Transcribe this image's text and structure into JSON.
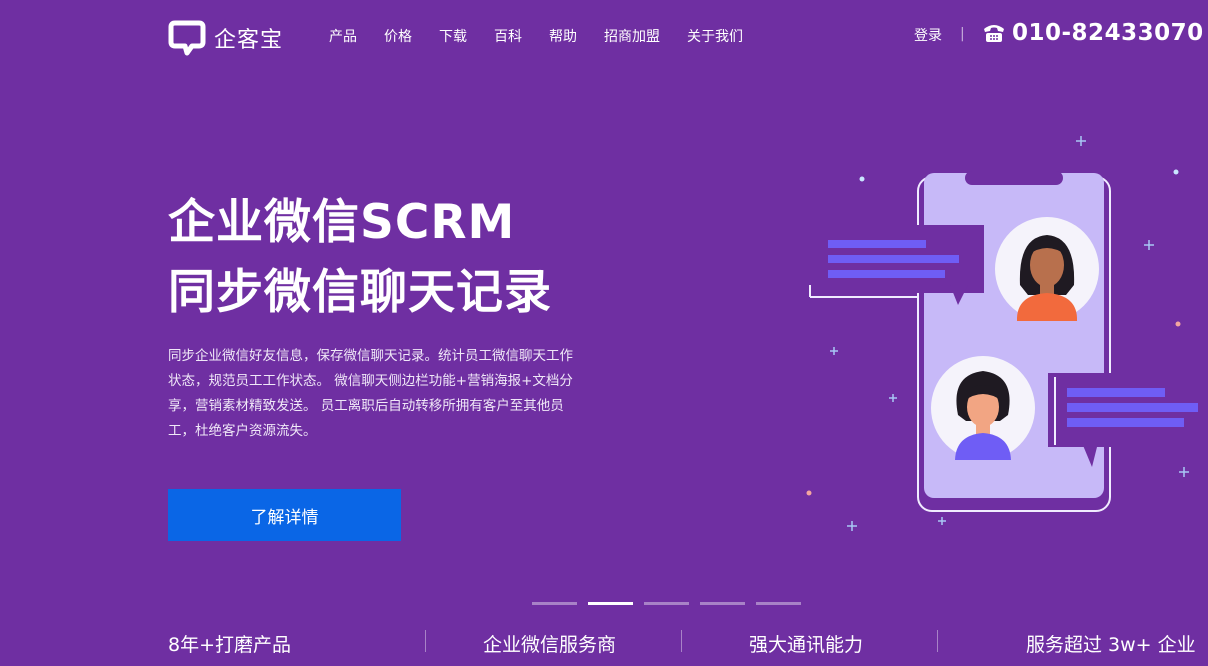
{
  "header": {
    "logo_text": "企客宝",
    "nav": [
      "产品",
      "价格",
      "下载",
      "百科",
      "帮助",
      "招商加盟",
      "关于我们"
    ],
    "login": "登录",
    "separator": "|",
    "phone": "010-82433070"
  },
  "hero": {
    "title_line1": "企业微信SCRM",
    "title_line2": "同步微信聊天记录",
    "description": "同步企业微信好友信息，保存微信聊天记录。统计员工微信聊天工作状态，规范员工工作状态。 微信聊天侧边栏功能+营销海报+文档分享，营销素材精致发送。 员工离职后自动转移所拥有客户至其他员工，杜绝客户资源流失。",
    "cta": "了解详情"
  },
  "carousel": {
    "count": 5,
    "active_index": 1
  },
  "features": [
    "8年+打磨产品",
    "企业微信服务商",
    "强大通讯能力",
    "服务超过 3w+ 企业"
  ],
  "colors": {
    "background": "#6f2fa2",
    "cta": "#0a66e6",
    "phone_screen": "#c7b9f8",
    "bubble_bar": "#6f5df5"
  },
  "icons": {
    "logo": "chat-bubble-logo-icon",
    "phone": "telephone-icon",
    "illustration": "phone-chat-illustration"
  }
}
